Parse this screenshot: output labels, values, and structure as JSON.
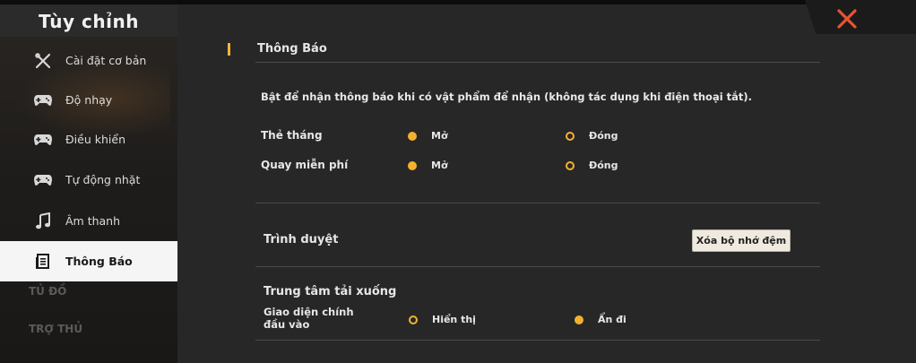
{
  "sidebar": {
    "title": "Tùy chỉnh",
    "items": [
      {
        "label": "Cài đặt cơ bản",
        "icon": "wrench-screwdriver-icon"
      },
      {
        "label": "Độ nhạy",
        "icon": "gamepad-icon"
      },
      {
        "label": "Điều khiển",
        "icon": "gamepad-icon"
      },
      {
        "label": "Tự động nhặt",
        "icon": "gamepad-icon"
      },
      {
        "label": "Âm thanh",
        "icon": "music-note-icon"
      },
      {
        "label": "Thông Báo",
        "icon": "notification-document-icon",
        "active": true
      }
    ],
    "ghost_items": [
      "TỦ ĐỒ",
      "TRỢ THỦ"
    ]
  },
  "main": {
    "section_title": "Thông Báo",
    "description": "Bật để nhận thông báo khi có vật phẩm để nhận (không tác dụng khi điện thoại tắt).",
    "notification_rows": [
      {
        "label": "Thẻ tháng",
        "options": [
          {
            "label": "Mở",
            "selected": true
          },
          {
            "label": "Đóng",
            "selected": false
          }
        ]
      },
      {
        "label": "Quay miễn phí",
        "options": [
          {
            "label": "Mở",
            "selected": true
          },
          {
            "label": "Đóng",
            "selected": false
          }
        ]
      }
    ],
    "browser": {
      "label": "Trình duyệt",
      "clear_cache_label": "Xóa bộ nhớ đệm"
    },
    "download_center": {
      "label": "Trung tâm tải xuống",
      "main_ui_label": "Giao diện chính đầu vào",
      "options": [
        {
          "label": "Hiển thị",
          "selected": false
        },
        {
          "label": "Ẩn đi",
          "selected": true
        }
      ]
    }
  },
  "colors": {
    "accent": "#f4b131",
    "close": "#e8542f",
    "active_bg": "#f5f5f5"
  }
}
